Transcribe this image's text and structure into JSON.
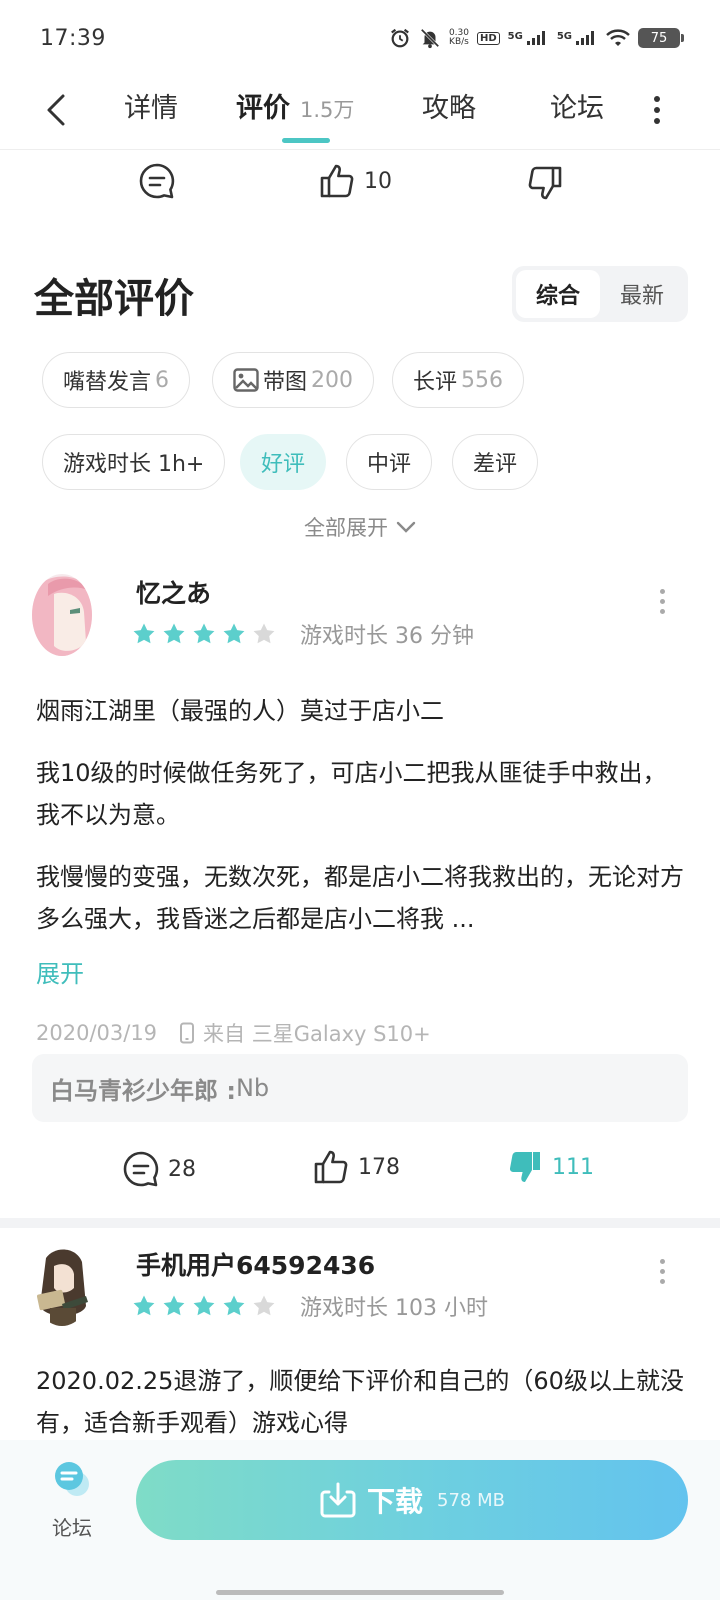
{
  "status_bar": {
    "time": "17:39",
    "net_speed_value": "0.30",
    "net_speed_unit": "KB/s",
    "hd_label": "HD",
    "hd_sub": "1 2",
    "sig1_label": "5G",
    "sig2_label": "5G",
    "battery": "75"
  },
  "nav": {
    "tabs": [
      {
        "label": "详情"
      },
      {
        "label": "评价",
        "count": "1.5万"
      },
      {
        "label": "攻略"
      },
      {
        "label": "论坛"
      }
    ],
    "active_tab": "评价"
  },
  "prev_review_actions": {
    "likes": "10"
  },
  "section": {
    "title": "全部评价",
    "sort_options": [
      "综合",
      "最新"
    ],
    "sort_active": "综合"
  },
  "filters": {
    "chips": [
      {
        "label": "嘴替发言",
        "count": "6"
      },
      {
        "label": "带图",
        "count": "200"
      },
      {
        "label": "长评",
        "count": "556"
      },
      {
        "label": "游戏时长 1h+",
        "count": ""
      },
      {
        "label": "好评",
        "count": ""
      },
      {
        "label": "中评",
        "count": ""
      },
      {
        "label": "差评",
        "count": ""
      }
    ],
    "active": "好评",
    "expand_all": "全部展开"
  },
  "reviews": [
    {
      "username": "忆之あ",
      "rating": 4,
      "max_rating": 5,
      "playtime": "游戏时长 36 分钟",
      "paragraphs": [
        "烟雨江湖里（最强的人）莫过于店小二",
        "我10级的时候做任务死了，可店小二把我从匪徒手中救出，我不以为意。",
        "我慢慢的变强，无数次死，都是店小二将我救出的，无论对方多么强大，我昏迷之后都是店小二将我 ..."
      ],
      "expand": "展开",
      "date": "2020/03/19",
      "device": "来自 三星Galaxy S10+",
      "reply_user": "白马青衫少年郎 : ",
      "reply_text": "Nb",
      "comments": "28",
      "likes": "178",
      "dislikes": "111",
      "dislike_active_color": "#3fbdbb"
    },
    {
      "username": "手机用户64592436",
      "rating": 4,
      "max_rating": 5,
      "playtime": "游戏时长 103 小时",
      "paragraphs": [
        "2020.02.25退游了，顺便给下评价和自己的（60级以上就没有，适合新手观看）游戏心得"
      ]
    }
  ],
  "bottom_bar": {
    "forum_label": "论坛",
    "download_label": "下载",
    "download_size": "578 MB"
  },
  "colors": {
    "accent": "#3fbdbb",
    "star_filled": "#5ccfcc",
    "star_empty": "#d9d9d9"
  }
}
